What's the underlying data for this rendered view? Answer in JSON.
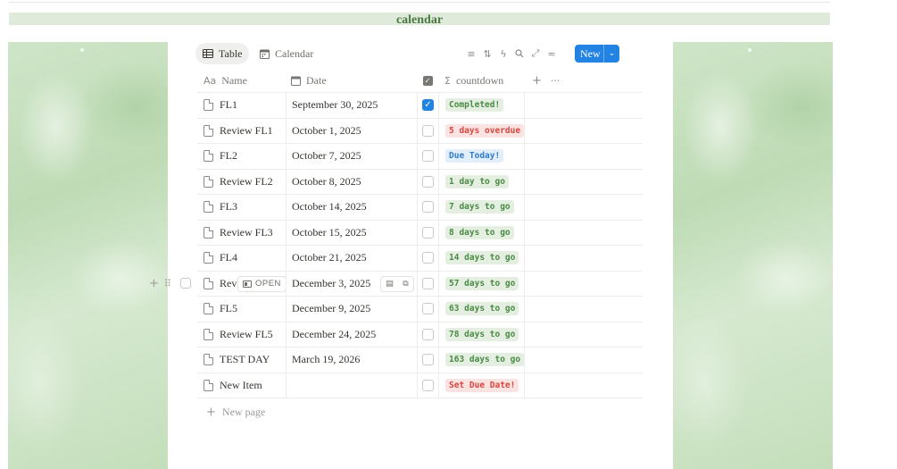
{
  "banner": {
    "title": "calendar"
  },
  "views": [
    {
      "label": "Table",
      "icon": "table-icon",
      "active": true
    },
    {
      "label": "Calendar",
      "icon": "calendar-icon",
      "active": false
    }
  ],
  "toolbar": {
    "icons": [
      "filter-icon",
      "sort-icon",
      "automation-icon",
      "search-icon",
      "expand-icon",
      "settings-icon"
    ],
    "new_label": "New"
  },
  "columns": {
    "name": "Name",
    "date": "Date",
    "countdown": "countdown"
  },
  "rows": [
    {
      "name": "FL1",
      "date": "September 30, 2025",
      "checked": true,
      "countdown": "Completed!",
      "tone": "green"
    },
    {
      "name": "Review FL1",
      "date": "October 1, 2025",
      "checked": false,
      "countdown": "5 days overdue",
      "tone": "red"
    },
    {
      "name": "FL2",
      "date": "October 7, 2025",
      "checked": false,
      "countdown": "Due Today!",
      "tone": "blue"
    },
    {
      "name": "Review FL2",
      "date": "October 8, 2025",
      "checked": false,
      "countdown": "1 day to go",
      "tone": "green"
    },
    {
      "name": "FL3",
      "date": "October 14, 2025",
      "checked": false,
      "countdown": "7 days to go",
      "tone": "green"
    },
    {
      "name": "Review FL3",
      "date": "October 15, 2025",
      "checked": false,
      "countdown": "8 days to go",
      "tone": "green"
    },
    {
      "name": "FL4",
      "date": "October 21, 2025",
      "checked": false,
      "countdown": "14 days to go",
      "tone": "green"
    },
    {
      "name": "Rev",
      "date": "December 3, 2025",
      "checked": false,
      "countdown": "57 days to go",
      "tone": "green",
      "hovered": true
    },
    {
      "name": "FL5",
      "date": "December 9, 2025",
      "checked": false,
      "countdown": "63 days to go",
      "tone": "green"
    },
    {
      "name": "Review FL5",
      "date": "December 24, 2025",
      "checked": false,
      "countdown": "78 days to go",
      "tone": "green"
    },
    {
      "name": "TEST DAY",
      "date": "March 19, 2026",
      "checked": false,
      "countdown": "163 days to go",
      "tone": "green"
    },
    {
      "name": "New Item",
      "date": "",
      "checked": false,
      "countdown": "Set Due Date!",
      "tone": "red"
    }
  ],
  "hover_row": {
    "open_label": "OPEN"
  },
  "new_page_label": "New page",
  "colors": {
    "accent": "#2383e2",
    "banner_bg": "#dfeadb",
    "banner_text": "#4a7a43"
  }
}
